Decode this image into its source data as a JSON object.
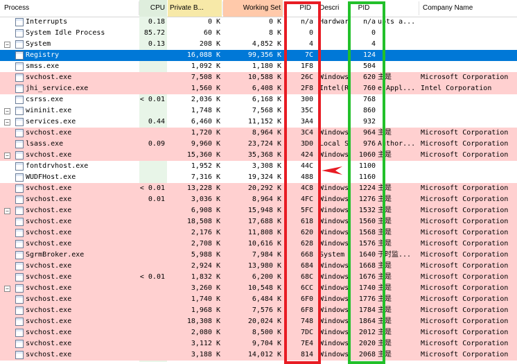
{
  "headers": {
    "process": "Process",
    "cpu": "CPU",
    "private": "Private B...",
    "working": "Working Set",
    "pid_hex": "PID",
    "descr": "Descri",
    "pid_dec": "PID",
    "company": "Company Name"
  },
  "colors": {
    "header_private": "#f7e9a8",
    "header_working": "#ffc9aa",
    "header_cpu": "#dfeedd",
    "service_row": "#ffd0d0",
    "selected_row": "#0078d7",
    "annotation_red": "#e81c24",
    "annotation_green": "#22c02a"
  },
  "rows": [
    {
      "name": "Interrupts",
      "cpu": "0.18",
      "private": "0 K",
      "working": "0 K",
      "pid": "n/a",
      "descr": "Hardwar",
      "pid2": "n/a",
      "extra": "upts a...",
      "company": "",
      "style": "white",
      "toggle": ""
    },
    {
      "name": "System Idle Process",
      "cpu": "85.72",
      "private": "60 K",
      "working": "8 K",
      "pid": "0",
      "descr": "",
      "pid2": "0",
      "extra": "",
      "company": "",
      "style": "white",
      "toggle": ""
    },
    {
      "name": "System",
      "cpu": "0.13",
      "private": "208 K",
      "working": "4,852 K",
      "pid": "4",
      "descr": "",
      "pid2": "4",
      "extra": "",
      "company": "",
      "style": "white",
      "toggle": "−"
    },
    {
      "name": "Registry",
      "cpu": "",
      "private": "16,088 K",
      "working": "99,356 K",
      "pid": "7C",
      "descr": "",
      "pid2": "124",
      "extra": "",
      "company": "",
      "style": "blue",
      "toggle": ""
    },
    {
      "name": "smss.exe",
      "cpu": "",
      "private": "1,092 K",
      "working": "1,180 K",
      "pid": "1F8",
      "descr": "",
      "pid2": "504",
      "extra": "",
      "company": "",
      "style": "white",
      "toggle": ""
    },
    {
      "name": "svchost.exe",
      "cpu": "",
      "private": "7,508 K",
      "working": "10,588 K",
      "pid": "26C",
      "descr": "Windows",
      "pid2": "620",
      "extra": "主是",
      "company": "Microsoft Corporation",
      "style": "pink",
      "toggle": ""
    },
    {
      "name": "jhi_service.exe",
      "cpu": "",
      "private": "1,560 K",
      "working": "6,408 K",
      "pid": "2F8",
      "descr": "Intel(R",
      "pid2": "760",
      "extra": "e Appl...",
      "company": "Intel Corporation",
      "style": "pink",
      "toggle": ""
    },
    {
      "name": "csrss.exe",
      "cpu": "< 0.01",
      "private": "2,036 K",
      "working": "6,168 K",
      "pid": "300",
      "descr": "",
      "pid2": "768",
      "extra": "",
      "company": "",
      "style": "white",
      "toggle": ""
    },
    {
      "name": "wininit.exe",
      "cpu": "",
      "private": "1,748 K",
      "working": "7,568 K",
      "pid": "35C",
      "descr": "",
      "pid2": "860",
      "extra": "",
      "company": "",
      "style": "white",
      "toggle": "−"
    },
    {
      "name": "services.exe",
      "cpu": "0.44",
      "private": "6,460 K",
      "working": "11,152 K",
      "pid": "3A4",
      "descr": "",
      "pid2": "932",
      "extra": "",
      "company": "",
      "style": "white",
      "toggle": "−"
    },
    {
      "name": "svchost.exe",
      "cpu": "",
      "private": "1,720 K",
      "working": "8,964 K",
      "pid": "3C4",
      "descr": "Windows",
      "pid2": "964",
      "extra": "主是",
      "company": "Microsoft Corporation",
      "style": "pink",
      "toggle": ""
    },
    {
      "name": "lsass.exe",
      "cpu": "0.09",
      "private": "9,960 K",
      "working": "23,724 K",
      "pid": "3D0",
      "descr": "Local S",
      "pid2": "976",
      "extra": "Author...",
      "company": "Microsoft Corporation",
      "style": "pink",
      "toggle": ""
    },
    {
      "name": "svchost.exe",
      "cpu": "",
      "private": "15,360 K",
      "working": "35,368 K",
      "pid": "424",
      "descr": "Windows",
      "pid2": "1060",
      "extra": "主是",
      "company": "Microsoft Corporation",
      "style": "pink",
      "toggle": "−"
    },
    {
      "name": "fontdrvhost.exe",
      "cpu": "",
      "private": "1,952 K",
      "working": "3,308 K",
      "pid": "44C",
      "descr": "",
      "pid2": "1100",
      "extra": "",
      "company": "",
      "style": "white",
      "toggle": ""
    },
    {
      "name": "WUDFHost.exe",
      "cpu": "",
      "private": "7,316 K",
      "working": "19,324 K",
      "pid": "488",
      "descr": "",
      "pid2": "1160",
      "extra": "",
      "company": "",
      "style": "white",
      "toggle": ""
    },
    {
      "name": "svchost.exe",
      "cpu": "< 0.01",
      "private": "13,228 K",
      "working": "20,292 K",
      "pid": "4C8",
      "descr": "Windows",
      "pid2": "1224",
      "extra": "主是",
      "company": "Microsoft Corporation",
      "style": "pink",
      "toggle": ""
    },
    {
      "name": "svchost.exe",
      "cpu": "0.01",
      "private": "3,036 K",
      "working": "8,964 K",
      "pid": "4FC",
      "descr": "Windows",
      "pid2": "1276",
      "extra": "主是",
      "company": "Microsoft Corporation",
      "style": "pink",
      "toggle": ""
    },
    {
      "name": "svchost.exe",
      "cpu": "",
      "private": "6,908 K",
      "working": "15,948 K",
      "pid": "5FC",
      "descr": "Windows",
      "pid2": "1532",
      "extra": "主是",
      "company": "Microsoft Corporation",
      "style": "pink",
      "toggle": "−"
    },
    {
      "name": "svchost.exe",
      "cpu": "",
      "private": "18,508 K",
      "working": "17,688 K",
      "pid": "618",
      "descr": "Windows",
      "pid2": "1560",
      "extra": "主是",
      "company": "Microsoft Corporation",
      "style": "pink",
      "toggle": ""
    },
    {
      "name": "svchost.exe",
      "cpu": "",
      "private": "2,176 K",
      "working": "11,808 K",
      "pid": "620",
      "descr": "Windows",
      "pid2": "1568",
      "extra": "主是",
      "company": "Microsoft Corporation",
      "style": "pink",
      "toggle": ""
    },
    {
      "name": "svchost.exe",
      "cpu": "",
      "private": "2,708 K",
      "working": "10,616 K",
      "pid": "628",
      "descr": "Windows",
      "pid2": "1576",
      "extra": "主是",
      "company": "Microsoft Corporation",
      "style": "pink",
      "toggle": ""
    },
    {
      "name": "SgrmBroker.exe",
      "cpu": "",
      "private": "5,988 K",
      "working": "7,984 K",
      "pid": "668",
      "descr": "System",
      "pid2": "1640",
      "extra": "于时监...",
      "company": "Microsoft Corporation",
      "style": "pink",
      "toggle": ""
    },
    {
      "name": "svchost.exe",
      "cpu": "",
      "private": "2,924 K",
      "working": "13,980 K",
      "pid": "684",
      "descr": "Windows",
      "pid2": "1668",
      "extra": "主是",
      "company": "Microsoft Corporation",
      "style": "pink",
      "toggle": ""
    },
    {
      "name": "svchost.exe",
      "cpu": "< 0.01",
      "private": "1,832 K",
      "working": "6,200 K",
      "pid": "68C",
      "descr": "Windows",
      "pid2": "1676",
      "extra": "主是",
      "company": "Microsoft Corporation",
      "style": "pink",
      "toggle": ""
    },
    {
      "name": "svchost.exe",
      "cpu": "",
      "private": "3,260 K",
      "working": "10,548 K",
      "pid": "6CC",
      "descr": "Windows",
      "pid2": "1740",
      "extra": "主是",
      "company": "Microsoft Corporation",
      "style": "pink",
      "toggle": "−"
    },
    {
      "name": "svchost.exe",
      "cpu": "",
      "private": "1,740 K",
      "working": "6,484 K",
      "pid": "6F0",
      "descr": "Windows",
      "pid2": "1776",
      "extra": "主是",
      "company": "Microsoft Corporation",
      "style": "pink",
      "toggle": ""
    },
    {
      "name": "svchost.exe",
      "cpu": "",
      "private": "1,968 K",
      "working": "7,576 K",
      "pid": "6F8",
      "descr": "Windows",
      "pid2": "1784",
      "extra": "主是",
      "company": "Microsoft Corporation",
      "style": "pink",
      "toggle": ""
    },
    {
      "name": "svchost.exe",
      "cpu": "",
      "private": "18,308 K",
      "working": "20,024 K",
      "pid": "748",
      "descr": "Windows",
      "pid2": "1864",
      "extra": "主是",
      "company": "Microsoft Corporation",
      "style": "pink",
      "toggle": ""
    },
    {
      "name": "svchost.exe",
      "cpu": "",
      "private": "2,080 K",
      "working": "8,500 K",
      "pid": "7DC",
      "descr": "Windows",
      "pid2": "2012",
      "extra": "主是",
      "company": "Microsoft Corporation",
      "style": "pink",
      "toggle": ""
    },
    {
      "name": "svchost.exe",
      "cpu": "",
      "private": "3,112 K",
      "working": "9,704 K",
      "pid": "7E4",
      "descr": "Windows",
      "pid2": "2020",
      "extra": "主是",
      "company": "Microsoft Corporation",
      "style": "pink",
      "toggle": ""
    },
    {
      "name": "svchost.exe",
      "cpu": "",
      "private": "3,188 K",
      "working": "14,012 K",
      "pid": "814",
      "descr": "Windows",
      "pid2": "2068",
      "extra": "主是",
      "company": "Microsoft Corporation",
      "style": "pink",
      "toggle": ""
    }
  ]
}
